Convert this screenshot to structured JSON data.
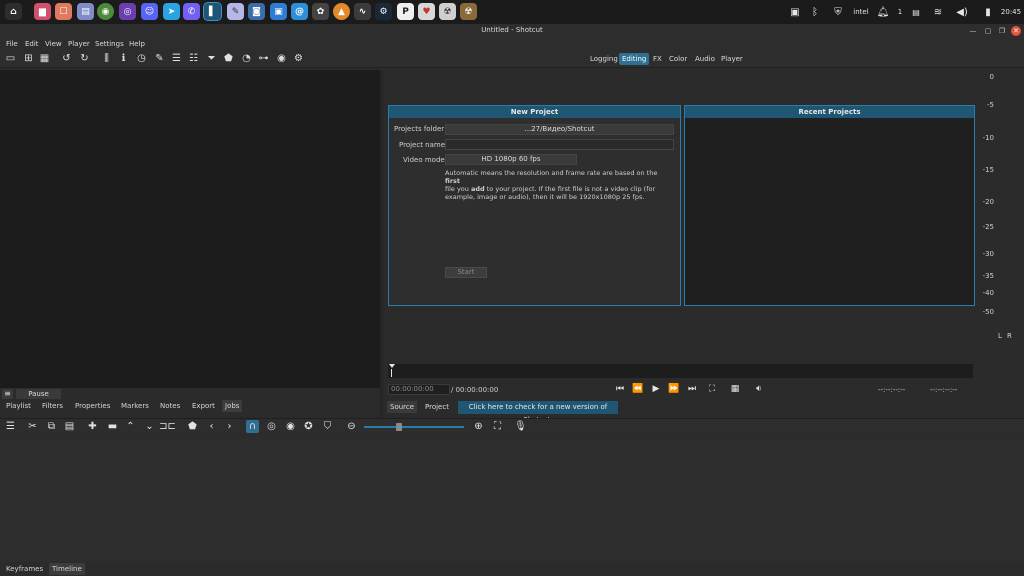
{
  "window_title": "Untitled - Shotcut",
  "clock": "20:45",
  "tray_counter": "1",
  "menu": [
    "File",
    "Edit",
    "View",
    "Player",
    "Settings",
    "Help"
  ],
  "layouts": [
    "Logging",
    "Editing",
    "FX",
    "Color",
    "Audio",
    "Player"
  ],
  "active_layout": "Editing",
  "new_project": {
    "title": "New Project",
    "folder_label": "Projects folder",
    "folder_value": "...27/Видео/Shotcut",
    "name_label": "Project name",
    "name_value": "",
    "video_label": "Video mode",
    "video_value": "HD 1080p 60 fps",
    "note_pre1": "Automatic means the resolution and frame rate are based on the ",
    "note_first": "first",
    "note_pre2": "file you ",
    "note_add": "add",
    "note_rest": " to your project. If the first file is not a video clip (for example, image or audio), then it will be 1920x1080p 25 fps.",
    "start_label": "Start"
  },
  "recent_projects": {
    "title": "Recent Projects"
  },
  "meter": {
    "ticks": [
      "0",
      "-5",
      "-10",
      "-15",
      "-20",
      "-25",
      "-30",
      "-35",
      "-40",
      "-50"
    ],
    "l": "L",
    "r": "R"
  },
  "left_dock": {
    "pause_label": "Pause",
    "tabs": [
      "Playlist",
      "Filters",
      "Properties",
      "Markers",
      "Notes",
      "Export",
      "Jobs"
    ]
  },
  "player": {
    "timecode": "00:00:00:00",
    "duration": "/ 00:00:00:00",
    "in_point": "--:--:--:--",
    "out_point": "--:--:--:--",
    "source_tab": "Source",
    "project_tab": "Project",
    "update_message": "Click here to check for a new version of Shotcut."
  },
  "bottom_tabs": [
    "Keyframes",
    "Timeline"
  ],
  "colors": {
    "accent": "#2f6f92",
    "panel_border": "#2b7bab",
    "viewer_bg": "#1c1c1c"
  }
}
